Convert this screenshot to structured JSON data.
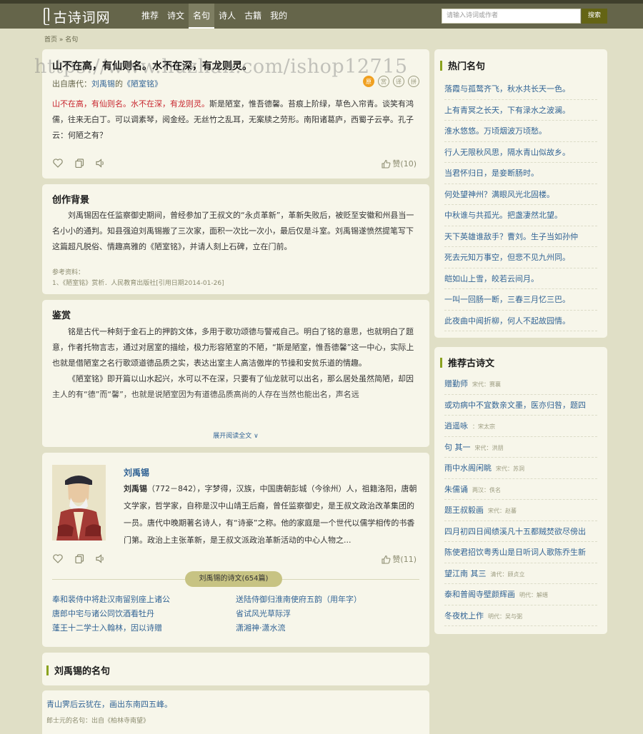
{
  "watermark": "https://www.huzhan.com/ishop12715",
  "site": {
    "logo_mark": "ᥫ",
    "logo_text": "古诗词网"
  },
  "nav": [
    {
      "label": "推荐"
    },
    {
      "label": "诗文"
    },
    {
      "label": "名句"
    },
    {
      "label": "诗人"
    },
    {
      "label": "古籍"
    },
    {
      "label": "我的"
    }
  ],
  "nav_active": "名句",
  "search": {
    "placeholder": "请输入诗词或作者",
    "button": "搜索"
  },
  "breadcrumb": {
    "home": "首页",
    "sep": "»",
    "current": "名句"
  },
  "poem": {
    "title": "山不在高，有仙则名。水不在深，有龙则灵。",
    "source_prefix": "出自唐代：",
    "author": "刘禹锡",
    "source_mid": "的",
    "work": "《陋室铭》",
    "circles": [
      "原",
      "赏",
      "译",
      "拼"
    ],
    "body_red": "山不在高，有仙则名。水不在深，有龙则灵。",
    "body_rest": "斯是陋室，惟吾德馨。苔痕上阶绿，草色入帘青。谈笑有鸿儒，往来无白丁。可以调素琴，阅金经。无丝竹之乱耳，无案牍之劳形。南阳诸葛庐，西蜀子云亭。孔子云：何陋之有？",
    "likes": "赞(10)"
  },
  "background": {
    "title": "创作背景",
    "text": "刘禹锡因在任监察御史期间，曾经参加了王叔文的“永贞革新”，革新失败后，被贬至安徽和州县当一名小小的通判。知县强迫刘禹锡搬了三次家，面积一次比一次小，最后仅是斗室。刘禹锡遂愤然提笔写下这篇超凡脱俗、情趣高雅的《陋室铭》，并请人刻上石碑，立在门前。",
    "ref_label": "参考资料：",
    "ref_1": "1、《陋室铭》赏析．人民教育出版社[引用日期2014-01-26]"
  },
  "appreciation": {
    "title": "鉴赏",
    "p1": "铭是古代一种刻于金石上的押韵文体，多用于歌功颂德与警戒自己。明白了铭的意思，也就明白了题意，作者托物言志，通过对居室的描绘，极力形容陋室的不陋，“斯是陋室，惟吾德馨”这一中心，实际上也就是借陋室之名行歌颂道德品质之实，表达出室主人高洁傲岸的节操和安贫乐道的情趣。",
    "p2": "《陋室铭》即开篇以山水起兴，水可以不在深，只要有了仙龙就可以出名，那么居处虽然简陋，却因主人的有“德”而“馨”，也就是说陋室因为有道德品质高尚的人存在当然也能出名，声名远",
    "expand": "展开阅读全文 ∨"
  },
  "author_card": {
    "name": "刘禹锡",
    "bio_name": "刘禹锡",
    "bio": "（772－842），字梦得，汉族，中国唐朝彭城（今徐州）人，祖籍洛阳，唐朝文学家，哲学家，自称是汉中山靖王后裔，曾任监察御史，是王叔文政治改革集团的一员。唐代中晚期著名诗人，有“诗豪”之称。他的家庭是一个世代以儒学相传的书香门第。政治上主张革新，是王叔文派政治革新活动的中心人物之...",
    "likes": "赞(11)",
    "works_pill": "刘禹锡的诗文(654篇)",
    "works": [
      "奉和裴侍中将赴汉南留别座上诸公",
      "送陆侍御归淮南使府五韵（用年字）",
      "唐郎中宅与诸公同饮酒看牡丹",
      "省试风光草际浮",
      "蓬王十二学士入翰林，因以诗赠",
      "潇湘神·潇水流"
    ]
  },
  "famous_by_author": {
    "title": "刘禹锡的名句",
    "quote": "青山霁后云犹在，画出东南四五峰。",
    "quote_src": "郎士元的名句：出自《柏林寺南望》"
  },
  "hot_quotes": {
    "title": "热门名句",
    "items": [
      "落霞与孤鹜齐飞，秋水共长天一色。",
      "上有青冥之长天，下有渌水之波澜。",
      "淮水悠悠。万顷烟波万顷愁。",
      "行人无限秋风思，隔水青山似故乡。",
      "当君怀归日，是妾断肠时。",
      "何处望神州？满眼风光北固楼。",
      "中秋谁与共孤光。把盏凄然北望。",
      "天下英雄谁敌手？曹刘。生子当如孙仲",
      "死去元知万事空，但悲不见九州同。",
      "皑如山上雪，皎若云间月。",
      "一叫一回肠一断，三春三月忆三巴。",
      "此夜曲中闻折柳，何人不起故园情。"
    ]
  },
  "recommended": {
    "title": "推荐古诗文",
    "items": [
      {
        "title": "赠勤师",
        "era": "宋代：赛襄"
      },
      {
        "title": "或劝病中不宜数亲文墨，医亦归咎，题四",
        "era": ""
      },
      {
        "title": "逍遥咏",
        "era": "：宋太宗"
      },
      {
        "title": "句 其一",
        "era": "宋代：洪朋"
      },
      {
        "title": "雨中水阁闲眺",
        "era": "宋代：苏洞"
      },
      {
        "title": "朱儒诵",
        "era": "两汉：佚名"
      },
      {
        "title": "题王叔毅画",
        "era": "宋代：赵蕃"
      },
      {
        "title": "四月初四日闻绩溪凡十五都贼焚欲尽傍出",
        "era": ""
      },
      {
        "title": "陈使君招饮粤秀山是日听词人歌陈乔生新",
        "era": ""
      },
      {
        "title": "望江南 其三",
        "era": "清代：顾贞立"
      },
      {
        "title": "泰和普阁寺壁颜辉画",
        "era": "明代：解缙"
      },
      {
        "title": "冬夜枕上作",
        "era": "明代：吴与弼"
      }
    ]
  }
}
